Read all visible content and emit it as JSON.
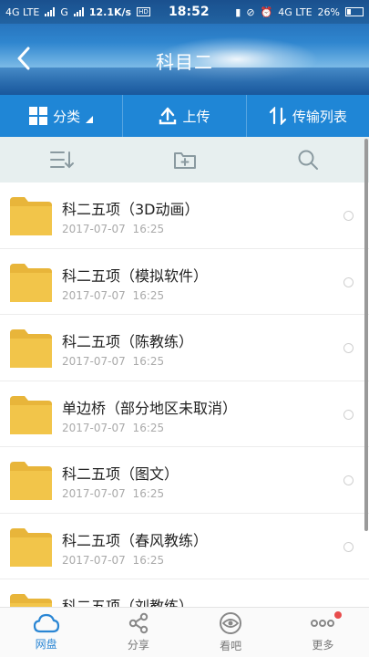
{
  "status_bar": {
    "network_left": "4G LTE",
    "network_mid": "G",
    "speed": "12.1K/s",
    "hd_badge": "HD",
    "time": "18:52",
    "network_right": "4G LTE",
    "battery": "26%"
  },
  "header": {
    "title": "科目二"
  },
  "toolbar": {
    "category_label": "分类",
    "upload_label": "上传",
    "transfer_label": "传输列表"
  },
  "files": [
    {
      "name": "科二五项（3D动画）",
      "date": "2017-07-07  16:25"
    },
    {
      "name": "科二五项（模拟软件）",
      "date": "2017-07-07  16:25"
    },
    {
      "name": "科二五项（陈教练）",
      "date": "2017-07-07  16:25"
    },
    {
      "name": "单边桥（部分地区未取消）",
      "date": "2017-07-07  16:25"
    },
    {
      "name": "科二五项（图文）",
      "date": "2017-07-07  16:25"
    },
    {
      "name": "科二五项（春风教练）",
      "date": "2017-07-07  16:25"
    },
    {
      "name": "科二五项（刘教练）",
      "date": ""
    }
  ],
  "bottom_nav": {
    "items": [
      {
        "label": "网盘",
        "icon": "cloud-icon",
        "active": true
      },
      {
        "label": "分享",
        "icon": "share-icon",
        "active": false
      },
      {
        "label": "看吧",
        "icon": "eye-icon",
        "active": false
      },
      {
        "label": "更多",
        "icon": "more-icon",
        "active": false,
        "badge": true
      }
    ]
  },
  "colors": {
    "toolbar_blue": "#1f86d6",
    "folder_yellow": "#f2c54a",
    "active_blue": "#2a86d4",
    "badge_red": "#e84c4c"
  }
}
